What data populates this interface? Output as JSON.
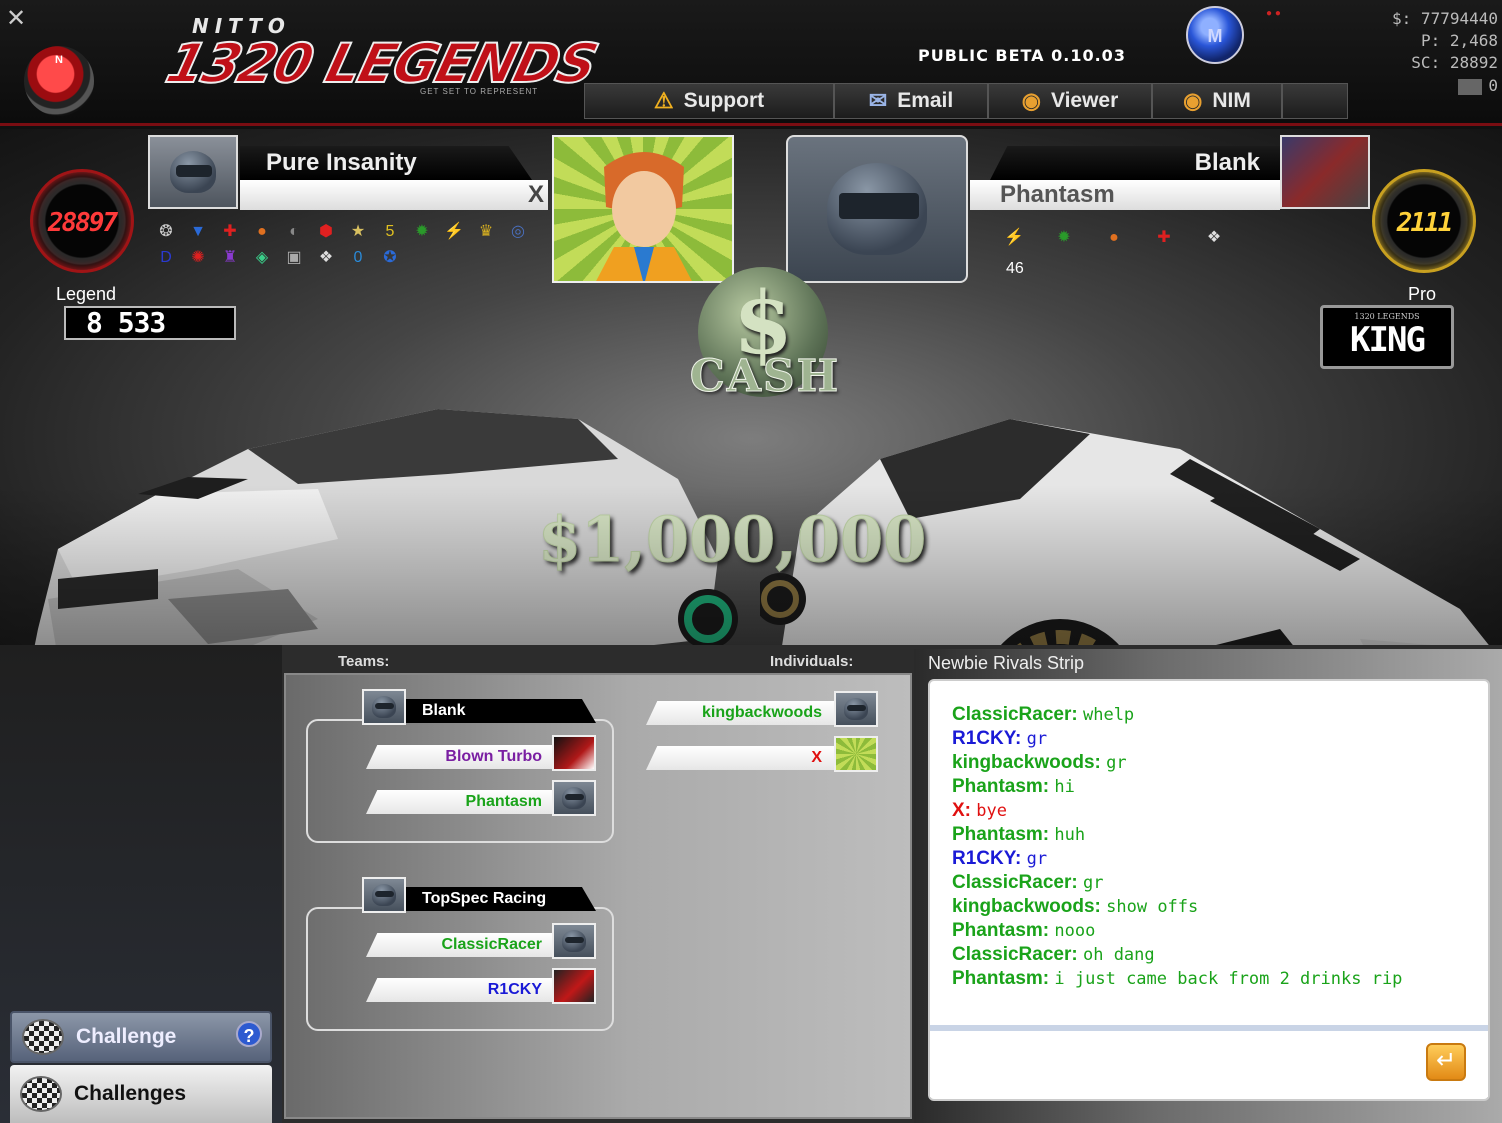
{
  "header": {
    "logo_top": "NITTO",
    "logo_main": "1320 LEGENDS",
    "logo_tagline": "GET SET TO REPRESENT",
    "n_button": "N",
    "beta_label": "PUBLIC BETA 0.10.03",
    "m_badge": "M",
    "stats": {
      "money": "$: 77794440",
      "points": "P: 2,468",
      "sc": "SC: 28892"
    },
    "mail_count": "0",
    "nav": [
      {
        "label": "Support",
        "icon": "warning-icon"
      },
      {
        "label": "Email",
        "icon": "envelope-icon"
      },
      {
        "label": "Viewer",
        "icon": "globe-icon"
      },
      {
        "label": "NIM",
        "icon": "chat-icon"
      }
    ]
  },
  "race": {
    "left": {
      "name": "Pure Insanity",
      "player": "X",
      "gauge": "28897",
      "class_label": "Legend",
      "plate": "8  533"
    },
    "right": {
      "name": "Blank",
      "player": "Phantasm",
      "gauge": "2111",
      "class_label": "Pro",
      "plate_small": "1320 LEGENDS",
      "plate_big": "KING",
      "badge_count": "46"
    },
    "cash_symbol": "$",
    "cash_word": "CASH",
    "prize": "$1,000,000"
  },
  "lobby": {
    "teams_header": "Teams:",
    "individuals_header": "Individuals:",
    "teams": [
      {
        "name": "Blank",
        "members": [
          {
            "name": "Blown Turbo",
            "color": "#7a1fa2"
          },
          {
            "name": "Phantasm",
            "color": "#1aa31a"
          }
        ]
      },
      {
        "name": "TopSpec Racing",
        "members": [
          {
            "name": "ClassicRacer",
            "color": "#1aa31a"
          },
          {
            "name": "R1CKY",
            "color": "#1a1ad6"
          }
        ]
      }
    ],
    "individuals": [
      {
        "name": "kingbackwoods",
        "color": "#1aa31a"
      },
      {
        "name": "X",
        "color": "#e01010"
      }
    ]
  },
  "sidebar": {
    "challenge": "Challenge",
    "help": "?",
    "challenges": "Challenges"
  },
  "chat": {
    "title": "Newbie Rivals Strip",
    "messages": [
      {
        "who": "ClassicRacer:",
        "text": "whelp",
        "color": "#1aa31a"
      },
      {
        "who": "R1CKY:",
        "text": "gr",
        "color": "#1a1ad6"
      },
      {
        "who": "kingbackwoods:",
        "text": "gr",
        "color": "#1aa31a"
      },
      {
        "who": "Phantasm:",
        "text": "hi",
        "color": "#1aa31a"
      },
      {
        "who": "X:",
        "text": "bye",
        "color": "#e01010"
      },
      {
        "who": "Phantasm:",
        "text": "huh",
        "color": "#1aa31a"
      },
      {
        "who": "R1CKY:",
        "text": "gr",
        "color": "#1a1ad6"
      },
      {
        "who": "ClassicRacer:",
        "text": "gr",
        "color": "#1aa31a"
      },
      {
        "who": "kingbackwoods:",
        "text": "show offs",
        "color": "#1aa31a"
      },
      {
        "who": "Phantasm:",
        "text": "nooo",
        "color": "#1aa31a"
      },
      {
        "who": "ClassicRacer:",
        "text": "oh dang",
        "color": "#1aa31a"
      },
      {
        "who": "Phantasm:",
        "text": "i just came back from 2 drinks rip",
        "color": "#1aa31a"
      }
    ],
    "input_value": "",
    "send_icon": "enter-icon"
  }
}
